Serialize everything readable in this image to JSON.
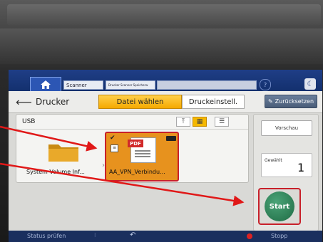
{
  "topbar": {
    "tabs": [
      "Scanner",
      "Drucker Scanner Speicherw",
      ""
    ],
    "help": "?",
    "moon": "☾"
  },
  "header": {
    "title": "Drucker",
    "tab_file": "Datei wählen",
    "tab_print": "Druckeinstell.",
    "reset": "Zurücksetzen"
  },
  "panel": {
    "source": "USB",
    "items": [
      {
        "label": "System Volume Inf...",
        "type": "folder"
      },
      {
        "label": "AA_VPN_Verbindu...",
        "type": "pdf",
        "badge": "PDF",
        "selected": true
      }
    ]
  },
  "right": {
    "preview": "Vorschau",
    "selected_label": "Gewählt",
    "selected_count": "1",
    "start": "Start"
  },
  "bottombar": {
    "status": "Status prüfen",
    "stop": "Stopp"
  },
  "colors": {
    "accent": "#f5a900",
    "topbar": "#1f3e86",
    "start": "#2a8a5a",
    "highlight": "#c8202a"
  }
}
